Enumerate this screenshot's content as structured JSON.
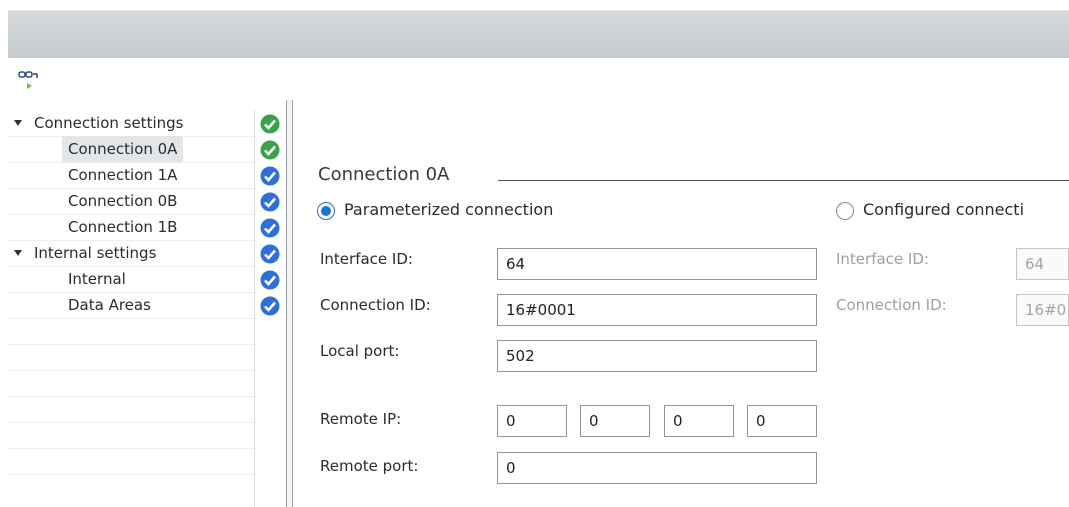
{
  "tree": {
    "items": [
      {
        "label": "Connection settings",
        "status": "ok-green"
      },
      {
        "label": "Connection 0A",
        "status": "ok-green"
      },
      {
        "label": "Connection 1A",
        "status": "ok-blue"
      },
      {
        "label": "Connection 0B",
        "status": "ok-blue"
      },
      {
        "label": "Connection 1B",
        "status": "ok-blue"
      },
      {
        "label": "Internal settings",
        "status": "ok-blue"
      },
      {
        "label": "Internal",
        "status": "ok-blue"
      },
      {
        "label": "Data Areas",
        "status": "ok-blue"
      }
    ],
    "selected": "Connection 0A"
  },
  "icons": {
    "toolbar": "connection-settings-icon",
    "status_green": "#3aa34a",
    "status_blue": "#2e6fd8"
  },
  "section": {
    "title": "Connection 0A"
  },
  "mode": {
    "parameterized_label": "Parameterized connection",
    "configured_label": "Configured connecti",
    "selected": "parameterized"
  },
  "parameterized": {
    "interface_id_label": "Interface ID:",
    "interface_id": "64",
    "connection_id_label": "Connection ID:",
    "connection_id": "16#0001",
    "local_port_label": "Local port:",
    "local_port": "502",
    "remote_ip_label": "Remote IP:",
    "remote_ip": [
      "0",
      "0",
      "0",
      "0"
    ],
    "remote_port_label": "Remote port:",
    "remote_port": "0"
  },
  "configured": {
    "interface_id_label": "Interface ID:",
    "interface_id": "64",
    "connection_id_label": "Connection ID:",
    "connection_id": "16#0"
  }
}
